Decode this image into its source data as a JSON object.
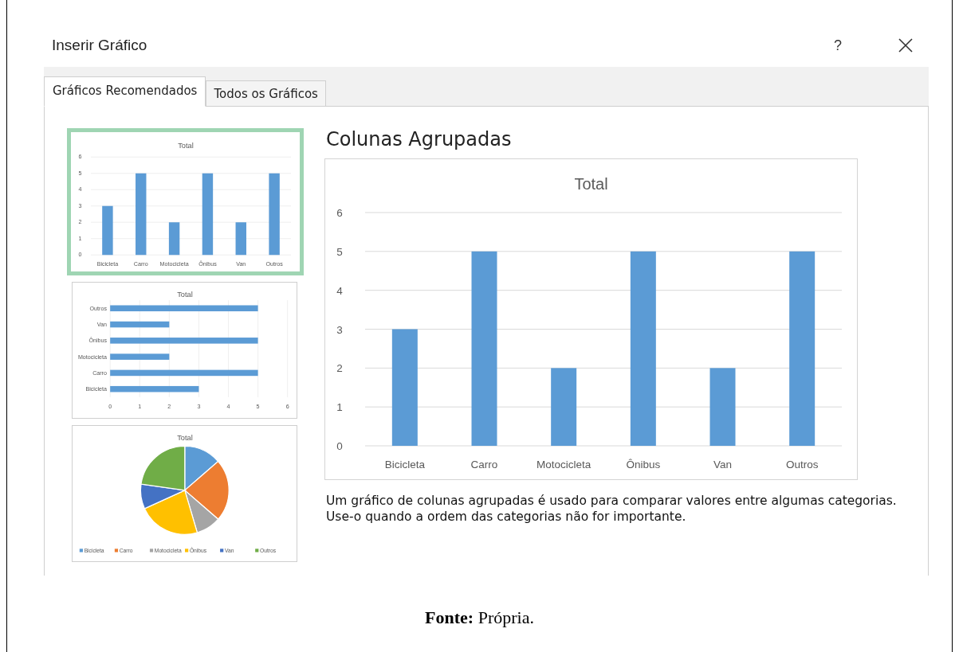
{
  "dialog": {
    "title": "Inserir Gráfico",
    "help": "?",
    "tabs": [
      {
        "label": "Gráficos Recomendados",
        "selected": true
      },
      {
        "label": "Todos os Gráficos",
        "selected": false
      }
    ],
    "thumbnails": [
      {
        "selected": true,
        "chart_data": {
          "type": "bar",
          "title": "Total",
          "categories": [
            "Bicicleta",
            "Carro",
            "Motocicleta",
            "Ônibus",
            "Van",
            "Outros"
          ],
          "values": [
            3,
            5,
            2,
            5,
            2,
            5
          ],
          "ylim": [
            0,
            6
          ],
          "yticks": [
            0,
            1,
            2,
            3,
            4,
            5,
            6
          ],
          "grid": true
        }
      },
      {
        "selected": false,
        "chart_data": {
          "type": "bar",
          "orientation": "horizontal",
          "title": "Total",
          "categories": [
            "Outros",
            "Van",
            "Ônibus",
            "Motocicleta",
            "Carro",
            "Bicicleta"
          ],
          "values": [
            5,
            2,
            5,
            2,
            5,
            3
          ],
          "xlim": [
            0,
            6
          ],
          "xticks": [
            0,
            1,
            2,
            3,
            4,
            5,
            6
          ],
          "grid": true
        }
      },
      {
        "selected": false,
        "chart_data": {
          "type": "pie",
          "title": "Total",
          "categories": [
            "Bicicleta",
            "Carro",
            "Motocicleta",
            "Ônibus",
            "Van",
            "Outros"
          ],
          "values": [
            13.63,
            22.73,
            9.09,
            22.73,
            9.09,
            22.73
          ],
          "colors": [
            "#5b9bd5",
            "#ed7d31",
            "#a5a5a5",
            "#ffc000",
            "#4472c4",
            "#70ad47"
          ],
          "legend": true
        }
      }
    ],
    "preview": {
      "title": "Colunas Agrupadas",
      "chart_data": {
        "type": "bar",
        "title": "Total",
        "categories": [
          "Bicicleta",
          "Carro",
          "Motocicleta",
          "Ônibus",
          "Van",
          "Outros"
        ],
        "values": [
          3,
          5,
          2,
          5,
          2,
          5
        ],
        "ylim": [
          0,
          6
        ],
        "yticks": [
          0,
          1,
          2,
          3,
          4,
          5,
          6
        ],
        "grid": true
      },
      "description": "Um gráfico de colunas agrupadas é usado para comparar valores entre algumas categorias. Use-o quando a ordem das categorias não for importante."
    }
  },
  "caption": "**Fonte:** Própria."
}
